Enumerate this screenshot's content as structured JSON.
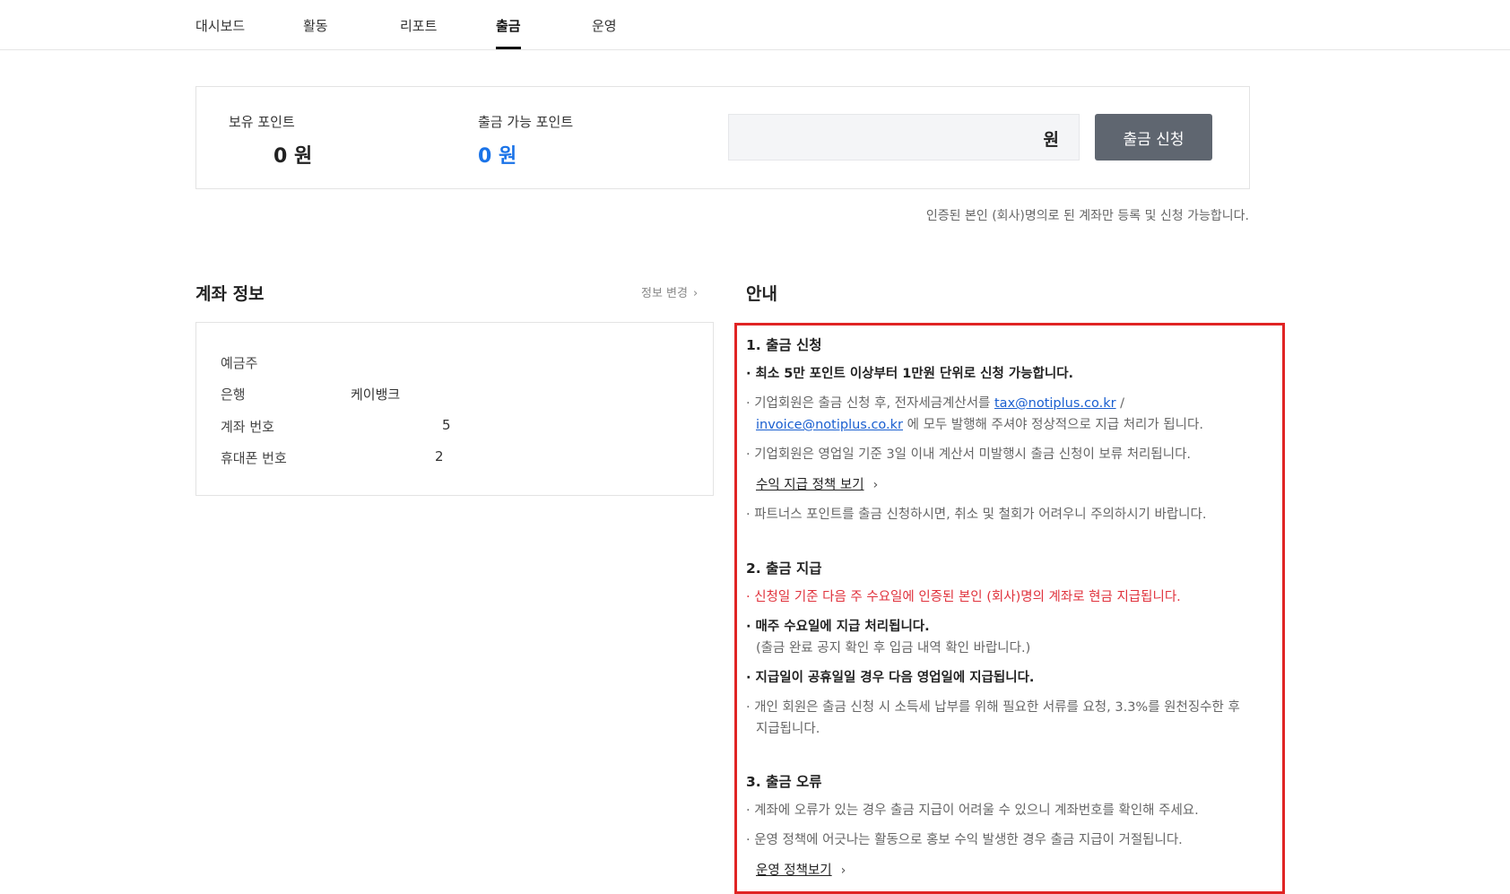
{
  "nav": {
    "tabs": [
      {
        "label": "대시보드"
      },
      {
        "label": "활동"
      },
      {
        "label": "리포트"
      },
      {
        "label": "출금"
      },
      {
        "label": "운영"
      }
    ],
    "active_tab": "출금"
  },
  "points": {
    "held_label": "보유 포인트",
    "held_value": "0 원",
    "available_label": "출금 가능 포인트",
    "available_value": "0 원",
    "amount_input_value": "",
    "amount_unit": "원",
    "withdraw_button": "출금 신청"
  },
  "account_notice": "인증된 본인 (회사)명의로 된 계좌만 등록 및 신청 가능합니다.",
  "account": {
    "title": "계좌 정보",
    "edit_link": "정보 변경",
    "rows": [
      {
        "label": "예금주",
        "value": ""
      },
      {
        "label": "은행",
        "value": "케이뱅크"
      },
      {
        "label": "계좌 번호",
        "value": "5"
      },
      {
        "label": "휴대폰 번호",
        "value": "2"
      }
    ]
  },
  "guide": {
    "title": "안내",
    "s1_title": "1. 출금 신청",
    "s1_l1": "· 최소 5만 포인트 이상부터 1만원 단위로 신청 가능합니다.",
    "s1_l2_pre": "· 기업회원은 출금 신청 후, 전자세금계산서를 ",
    "s1_l2_email1": "tax@notiplus.co.kr",
    "s1_l2_slash": " /",
    "s1_l3_email2": "invoice@notiplus.co.kr",
    "s1_l3_post": " 에 모두 발행해 주셔야 정상적으로 지급 처리가 됩니다.",
    "s1_l4": "· 기업회원은 영업일 기준 3일 이내 계산서 미발행시 출금 신청이 보류 처리됩니다.",
    "s1_policy_link": "수익 지급 정책 보기",
    "s1_l5": "· 파트너스 포인트를 출금 신청하시면, 취소 및 철회가 어려우니 주의하시기 바랍니다.",
    "s2_title": "2. 출금 지급",
    "s2_l1": "· 신청일 기준 다음 주 수요일에 인증된 본인 (회사)명의 계좌로 현금 지급됩니다.",
    "s2_l2": "· 매주 수요일에 지급 처리됩니다.",
    "s2_l3": "(출금 완료 공지 확인 후 입금 내역 확인 바랍니다.)",
    "s2_l4": "· 지급일이 공휴일일 경우 다음 영업일에 지급됩니다.",
    "s2_l5": "· 개인 회원은 출금 신청 시 소득세 납부를 위해 필요한 서류를 요청, 3.3%를 원천징수한 후",
    "s2_l6": "지급됩니다.",
    "s3_title": "3. 출금 오류",
    "s3_l1": "· 계좌에 오류가 있는 경우 출금 지급이 어려울 수 있으니 계좌번호를 확인해 주세요.",
    "s3_l2": "· 운영 정책에 어긋나는 활동으로 홍보 수익 발생한 경우 출금 지급이 거절됩니다.",
    "s3_policy_link": "운영 정책보기"
  },
  "chevron_glyph": "›"
}
